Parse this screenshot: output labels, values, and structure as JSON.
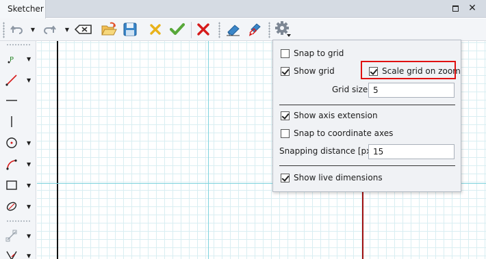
{
  "window": {
    "tab_title": "Sketcher"
  },
  "toolbar": {
    "items": [
      "undo-icon",
      "redo-icon",
      "clear-icon",
      "open-icon",
      "save-icon",
      "cancel-icon",
      "confirm-icon",
      "delete-icon",
      "eraser-icon",
      "eraser-pen-icon",
      "settings-icon"
    ]
  },
  "palette": {
    "items": [
      "point-icon",
      "line-icon",
      "horizontal-line-icon",
      "vertical-line-icon",
      "circle-icon",
      "arc-icon",
      "rectangle-icon",
      "ellipse-icon",
      "constraint-icon",
      "angle-constraint-icon"
    ]
  },
  "settings": {
    "snap_to_grid": {
      "label": "Snap to grid",
      "checked": false
    },
    "show_grid": {
      "label": "Show grid",
      "checked": true
    },
    "scale_grid_on_zoom": {
      "label": "Scale grid on zoom",
      "checked": true
    },
    "grid_size": {
      "label": "Grid size:",
      "value": "5"
    },
    "show_axis_extension": {
      "label": "Show axis extension",
      "checked": true
    },
    "snap_to_coordinate_axes": {
      "label": "Snap to coordinate axes",
      "checked": false
    },
    "snapping_distance": {
      "label": "Snapping distance [px]:",
      "value": "15"
    },
    "show_live_dimensions": {
      "label": "Show live dimensions",
      "checked": true
    }
  },
  "colors": {
    "highlight": "#e01010",
    "axis_vertical": "#111111",
    "axis_red": "#a01010",
    "axis_extension": "#7fd3de"
  }
}
